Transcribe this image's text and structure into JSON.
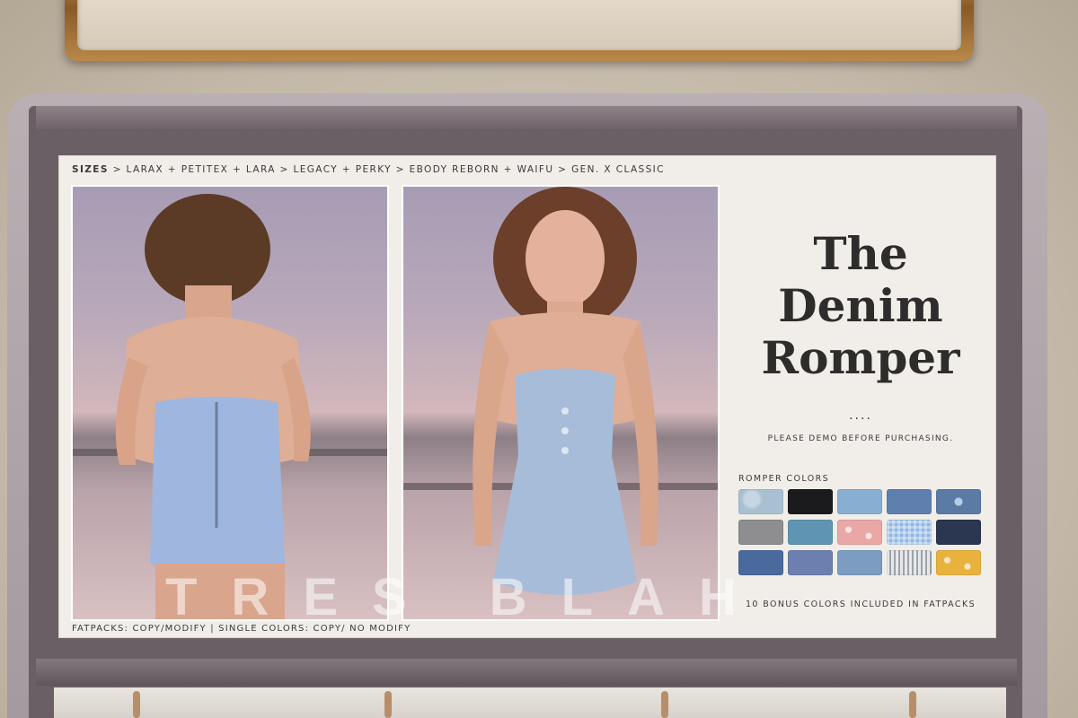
{
  "store_sign": {
    "text": "TRES BLAH"
  },
  "poster": {
    "sizes_lead": "SIZES",
    "sizes_rest": " > LARAX + PETITEX + LARA > LEGACY + PERKY > EBODY REBORN + WAIFU > GEN. X CLASSIC",
    "title_lines": [
      "The",
      "Denim",
      "Romper"
    ],
    "dots": "....",
    "demo_note": "PLEASE DEMO BEFORE PURCHASING.",
    "colors_label": "ROMPER COLORS",
    "bonus_note": "10 BONUS COLORS INCLUDED IN FATPACKS",
    "fatpacks_note": "FATPACKS: COPY/MODIFY | SINGLE COLORS: COPY/ NO MODIFY",
    "watermark": "TRES BLAH"
  },
  "swatches": [
    {
      "name": "light-acid-wash",
      "color": "#a9c0d3"
    },
    {
      "name": "black",
      "color": "#1b1b1d"
    },
    {
      "name": "light-blue",
      "color": "#88aed1"
    },
    {
      "name": "medium-blue",
      "color": "#5f7fae"
    },
    {
      "name": "blue-flower",
      "color": "#5b7aa6"
    },
    {
      "name": "grey",
      "color": "#8e8e90"
    },
    {
      "name": "teal-blue",
      "color": "#5f95b3"
    },
    {
      "name": "pink-floral",
      "color": "#e9a7a6"
    },
    {
      "name": "blue-gingham",
      "color": "#8fb6e3"
    },
    {
      "name": "navy",
      "color": "#2b3650"
    },
    {
      "name": "indigo",
      "color": "#4a6a9e"
    },
    {
      "name": "blue-print",
      "color": "#6c7fae"
    },
    {
      "name": "faded-blue",
      "color": "#7d9cc2"
    },
    {
      "name": "grey-stripe",
      "color": "#c5c8cc"
    },
    {
      "name": "yellow-floral",
      "color": "#e9b23c"
    }
  ],
  "colors": {
    "poster_bg": "#f1eee9",
    "text": "#3b3a39",
    "kiosk": "#6a5f64"
  }
}
